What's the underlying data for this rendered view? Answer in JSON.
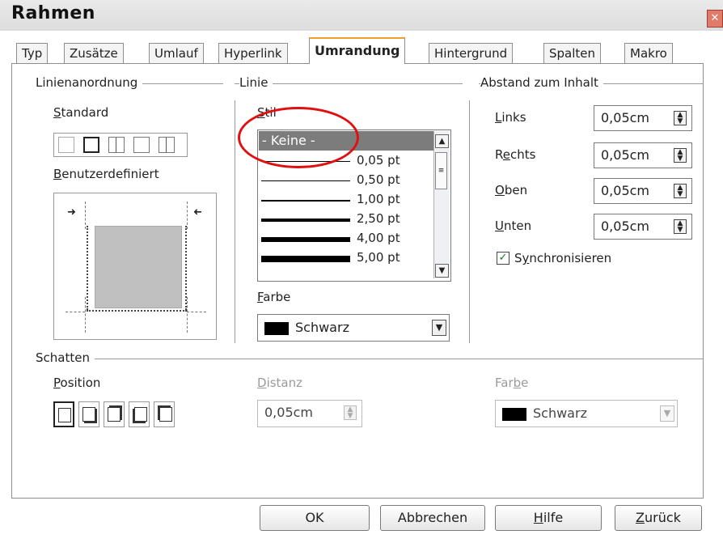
{
  "window": {
    "title": "Rahmen"
  },
  "tabs": [
    {
      "label": "Typ"
    },
    {
      "label": "Zusätze"
    },
    {
      "label": "Umlauf"
    },
    {
      "label": "Hyperlink"
    },
    {
      "label": "Umrandung",
      "active": true
    },
    {
      "label": "Hintergrund"
    },
    {
      "label": "Spalten"
    },
    {
      "label": "Makro"
    }
  ],
  "linienanordnung": {
    "heading": "Linienanordnung",
    "standard_label": "Standard",
    "custom_label": "Benutzerdefiniert"
  },
  "linie": {
    "heading": "Linie",
    "style_label": "Stil",
    "styles": [
      {
        "label": "- Keine -",
        "selected": true
      },
      {
        "label": "0,05 pt"
      },
      {
        "label": "0,50 pt"
      },
      {
        "label": "1,00 pt"
      },
      {
        "label": "2,50 pt"
      },
      {
        "label": "4,00 pt"
      },
      {
        "label": "5,00 pt"
      }
    ],
    "color_label": "Farbe",
    "color_value": "Schwarz",
    "color_hex": "#000000"
  },
  "abstand": {
    "heading": "Abstand zum Inhalt",
    "fields": [
      {
        "label": "Links",
        "value": "0,05cm"
      },
      {
        "label": "Rechts",
        "value": "0,05cm"
      },
      {
        "label": "Oben",
        "value": "0,05cm"
      },
      {
        "label": "Unten",
        "value": "0,05cm"
      }
    ],
    "sync_label": "Synchronisieren",
    "sync_checked": true
  },
  "schatten": {
    "heading": "Schatten",
    "position_label": "Position",
    "distance_label": "Distanz",
    "distance_value": "0,05cm",
    "color_label": "Farbe",
    "color_value": "Schwarz"
  },
  "buttons": {
    "ok": "OK",
    "cancel": "Abbrechen",
    "help": "Hilfe",
    "back": "Zurück"
  },
  "annotation": {
    "color": "#e01010"
  }
}
